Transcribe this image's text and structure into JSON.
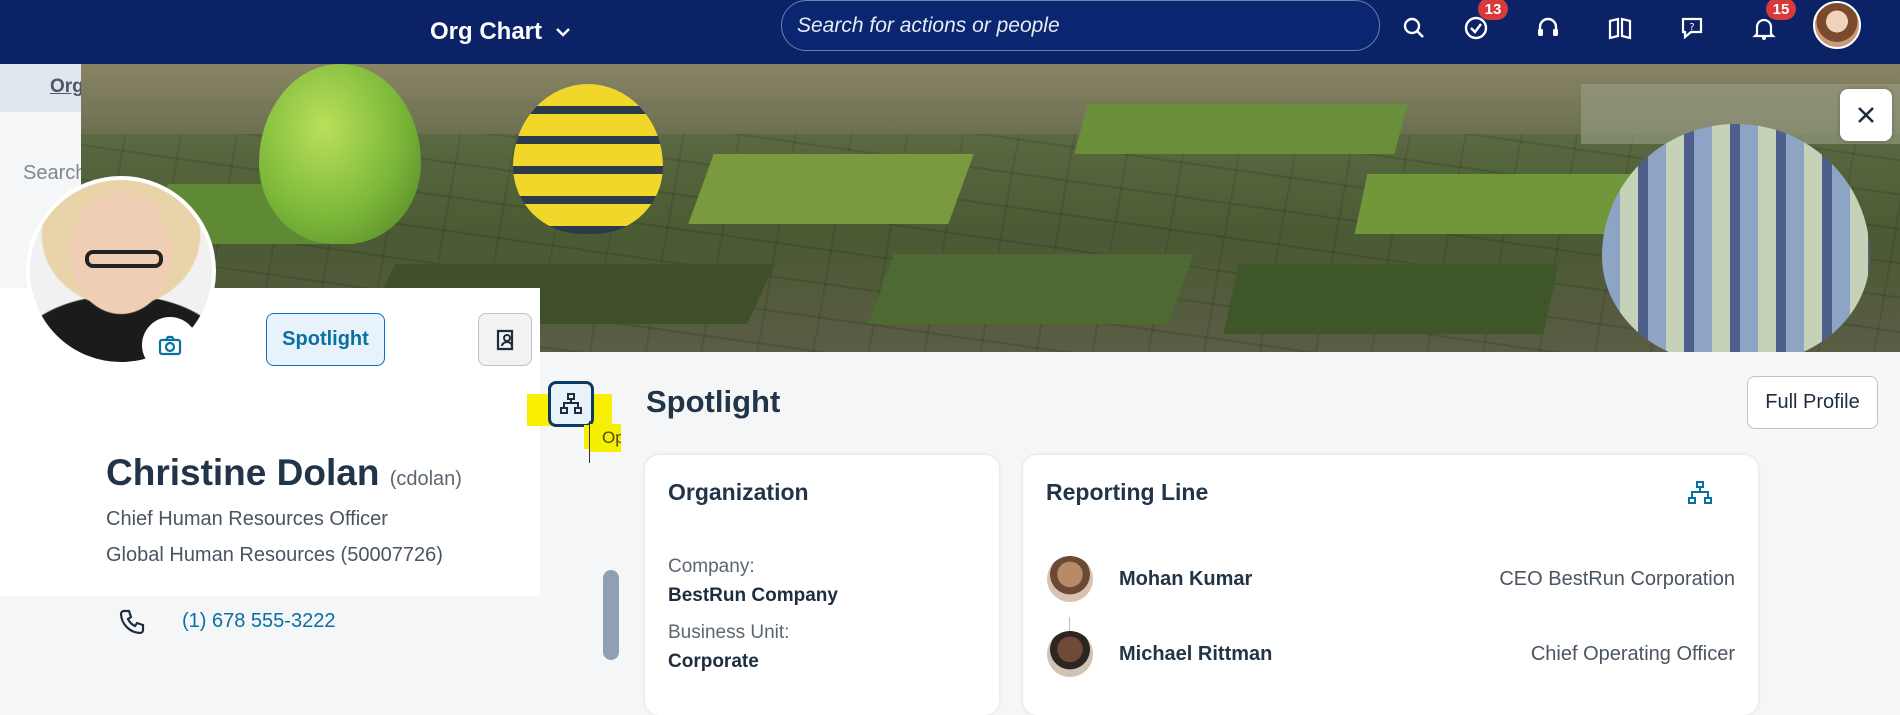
{
  "shell": {
    "app_title": "Org Chart",
    "search_placeholder": "Search for actions or people",
    "todo_badge": "13",
    "notification_badge": "15"
  },
  "background": {
    "tab_label": "Org",
    "search_label": "Search"
  },
  "profile": {
    "name": "Christine Dolan",
    "user_id": "(cdolan)",
    "job_title": "Chief Human Resources Officer",
    "department": "Global Human Resources (50007726)",
    "phone": "(1) 678 555-3222"
  },
  "actions": {
    "spotlight_label": "Spotlight",
    "tooltip": "Open Org Chart",
    "full_profile_label": "Full Profile"
  },
  "content": {
    "section_title": "Spotlight",
    "organization": {
      "title": "Organization",
      "company_label": "Company:",
      "company_value": "BestRun Company",
      "business_unit_label": "Business Unit:",
      "business_unit_value": "Corporate"
    },
    "reporting_line": {
      "title": "Reporting Line",
      "people": [
        {
          "name": "Mohan Kumar",
          "role": "CEO BestRun Corporation"
        },
        {
          "name": "Michael Rittman",
          "role": "Chief Operating Officer"
        }
      ]
    }
  },
  "colors": {
    "shell_background": "#0b2266",
    "accent": "#0a6fa3",
    "highlight": "#f8f000",
    "badge": "#d73a3a"
  }
}
